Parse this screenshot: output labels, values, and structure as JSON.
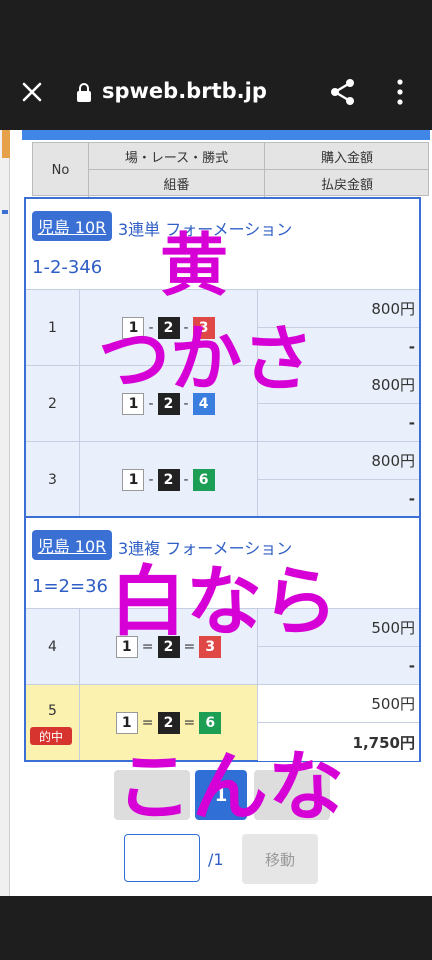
{
  "browser": {
    "url": "spweb.brtb.jp"
  },
  "header": {
    "no": "No",
    "venue_race_type": "場・レース・勝式",
    "combination": "組番",
    "purchase_amount": "購入金額",
    "payout_amount": "払戻金額"
  },
  "blocks": [
    {
      "venue": "児島 10R",
      "bet_type": "3連単 フォーメーション",
      "combo": "1-2-346",
      "rows": [
        {
          "no": "1",
          "amount": "800円",
          "payout": "-"
        },
        {
          "no": "2",
          "amount": "800円",
          "payout": "-"
        },
        {
          "no": "3",
          "amount": "800円",
          "payout": "-"
        }
      ]
    },
    {
      "venue": "児島 10R",
      "bet_type": "3連複 フォーメーション",
      "combo": "1=2=36",
      "rows": [
        {
          "no": "4",
          "amount": "500円",
          "payout": "-"
        },
        {
          "no": "5",
          "amount": "500円",
          "payout": "1,750円",
          "hit_label": "的中"
        }
      ]
    }
  ],
  "numbers": {
    "n1": "1",
    "n2": "2",
    "n3": "3",
    "n4": "4",
    "n6": "6",
    "dash": "-",
    "eq": "="
  },
  "pager": {
    "current": "1",
    "total": "/1",
    "move": "移動"
  },
  "overlay_text": {
    "line1": "黄",
    "line2": "つかさ",
    "line3": "白なら",
    "line4": "こんな"
  },
  "colors": {
    "accent": "#3b6fd4",
    "overlay": "#d600d6",
    "hit_bg": "#fbf2b0"
  }
}
